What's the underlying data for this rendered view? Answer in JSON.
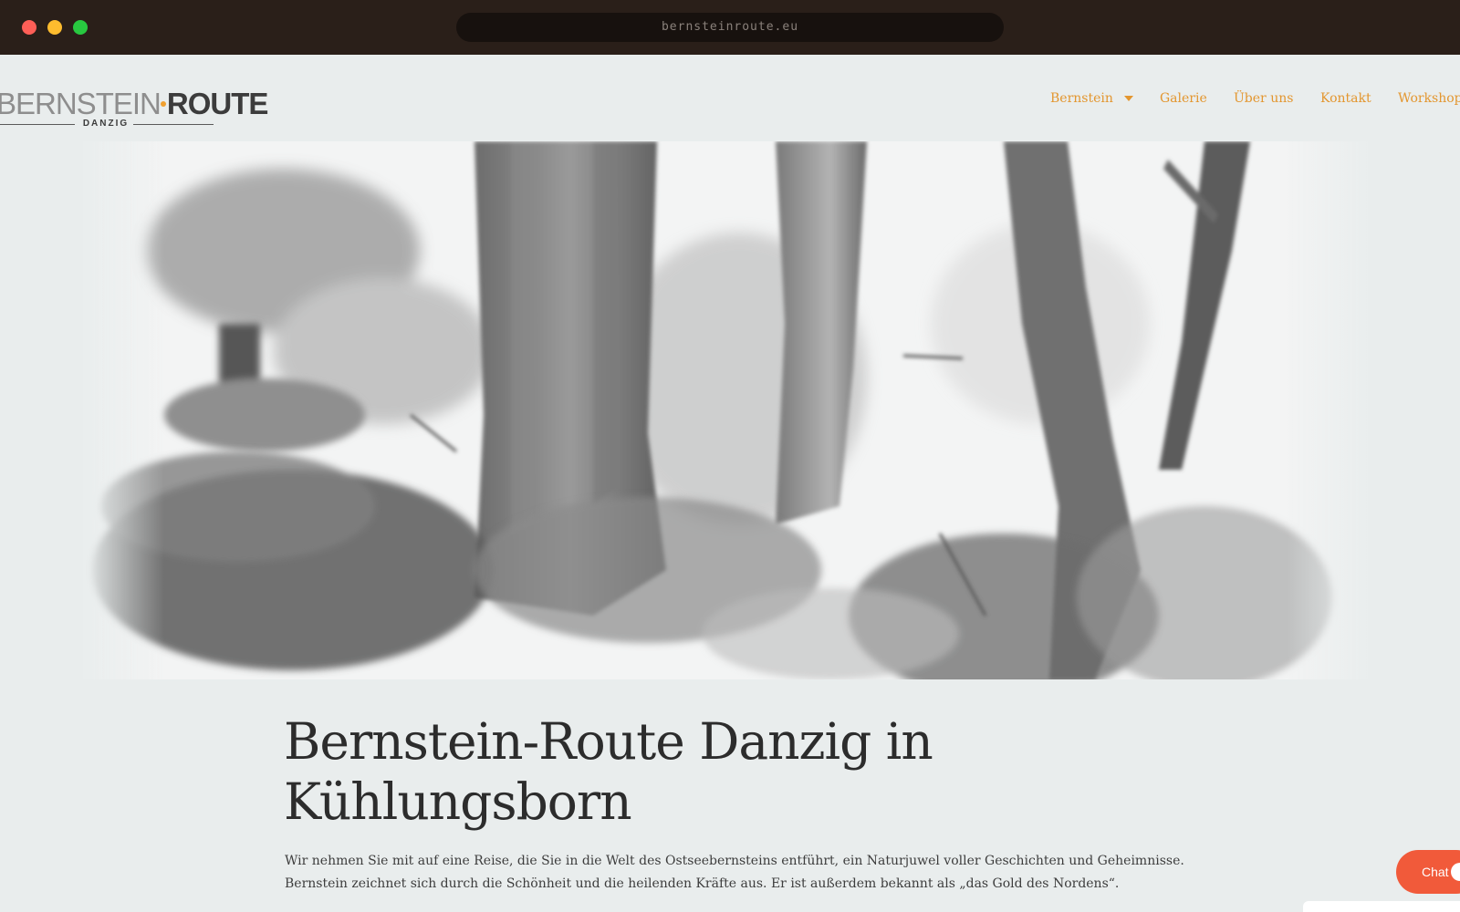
{
  "browser": {
    "url": "bernsteinroute.eu"
  },
  "logo": {
    "light_text": "BERNSTEIN",
    "bold_text": "ROUTE",
    "subtitle": "DANZIG"
  },
  "nav": {
    "items": [
      {
        "label": "Bernstein",
        "has_dropdown": true
      },
      {
        "label": "Galerie"
      },
      {
        "label": "Über uns"
      },
      {
        "label": "Kontakt"
      },
      {
        "label": "Workshop"
      }
    ]
  },
  "main": {
    "headline_line1": "Bernstein-Route Danzig in",
    "headline_line2": "Kühlungsborn",
    "intro": "Wir nehmen Sie mit auf eine Reise, die Sie in die Welt des Ostseebernsteins entführt, ein Naturjuwel voller Geschichten und Geheimnisse. Bernstein zeichnet sich durch die Schönheit und die heilenden Kräfte aus. Er ist außerdem bekannt als „das Gold des Nordens“."
  },
  "chat": {
    "label": "Chat"
  },
  "colors": {
    "accent": "#e3962f",
    "chrome": "#2a1f19",
    "background": "#e9eded",
    "chat": "#f15a3a",
    "logo_dot": "#f0a030"
  }
}
